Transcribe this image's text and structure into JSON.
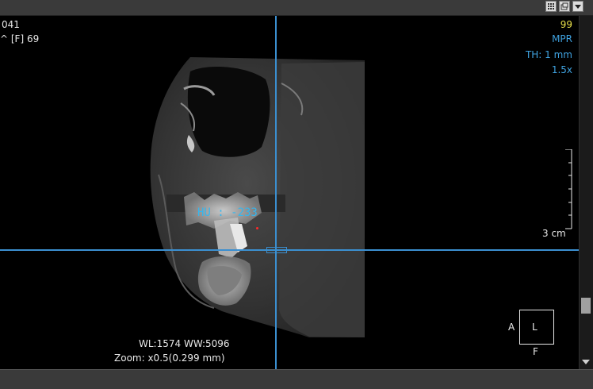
{
  "toolbar": {
    "icons": [
      "grid-layout-icon",
      "window-restore-icon",
      "dropdown-arrow-icon"
    ]
  },
  "overlay": {
    "top_left_line1": "041",
    "top_left_line2": "^ [F] 69",
    "slice_number": "99",
    "view_mode": "MPR",
    "thickness": "TH: 1 mm",
    "magnification": "1.5x",
    "ruler_label": "3 cm",
    "window_level": "WL:1574 WW:5096",
    "zoom": "Zoom: x0.5(0.299 mm)",
    "hu_value": "HU : -233"
  },
  "orientation": {
    "center": "L",
    "left": "A",
    "bottom": "F"
  },
  "colors": {
    "crosshair": "#3b8fd0",
    "overlay_blue": "#3fa2e0",
    "overlay_yellow": "#e8e04a",
    "hu_marker": "#ff2a2a"
  }
}
